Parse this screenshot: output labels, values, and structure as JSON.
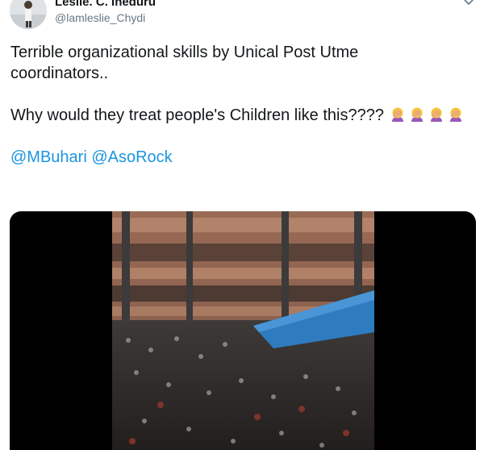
{
  "author": {
    "name": "Leslie. C. Iheduru",
    "handle": "@lamleslie_Chydi",
    "avatar_icon": "user-avatar-photo"
  },
  "tweet": {
    "line1": "Terrible organizational skills by Unical Post Utme",
    "line2": "coordinators..",
    "question": "Why would they treat people's Children like this????",
    "emoji_name": "woman-facepalming-emoji",
    "emoji_count": 4,
    "mentions": [
      "@MBuhari",
      "@AsoRock"
    ]
  },
  "menu": {
    "icon": "chevron-down-icon"
  },
  "media": {
    "type": "video",
    "background": "#000000"
  },
  "colors": {
    "text": "#14171a",
    "secondary": "#657786",
    "link": "#1b95e0",
    "emoji_hair": "#f5c33b",
    "emoji_skin": "#f0b27a",
    "emoji_shirt": "#9b59b6"
  }
}
